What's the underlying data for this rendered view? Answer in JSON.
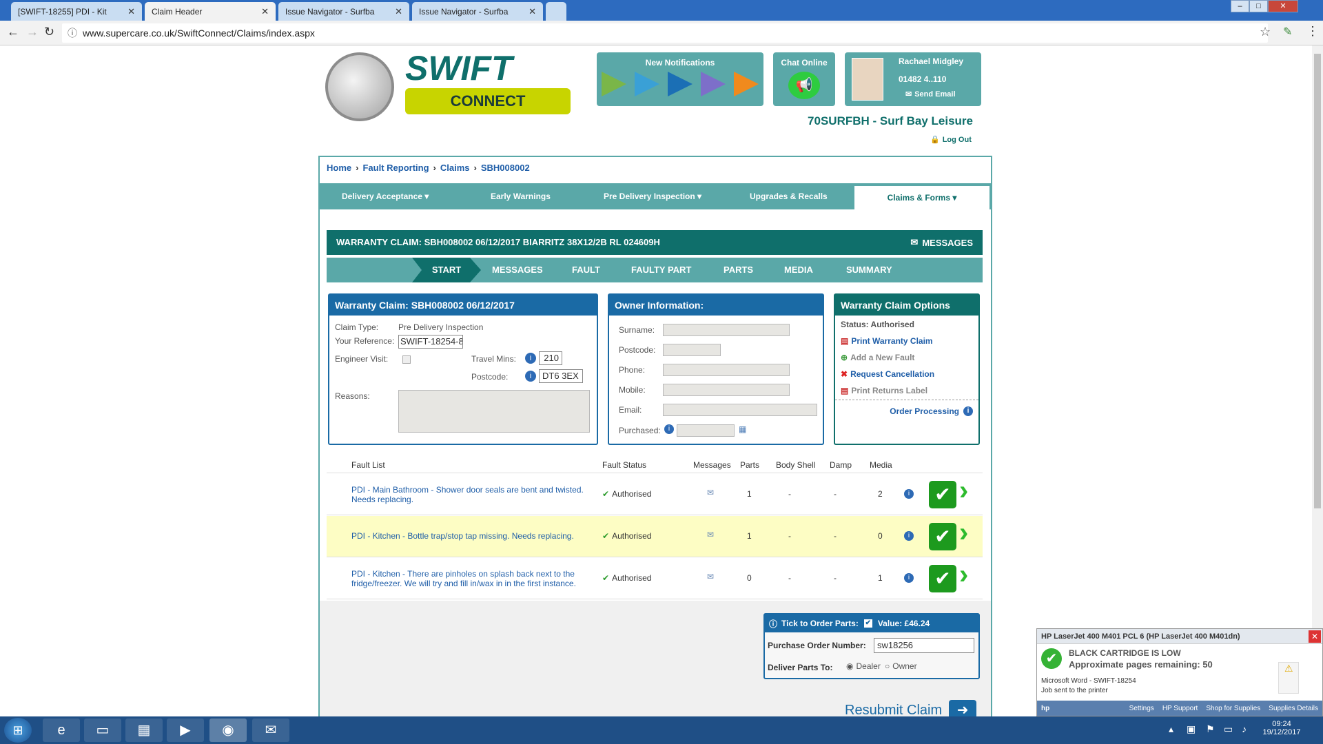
{
  "browser": {
    "tabs": [
      {
        "title": "[SWIFT-18255] PDI - Kit",
        "active": false
      },
      {
        "title": "Claim Header",
        "active": true
      },
      {
        "title": "Issue Navigator - Surfba",
        "active": false
      },
      {
        "title": "Issue Navigator - Surfba",
        "active": false
      }
    ],
    "url": "www.supercare.co.uk/SwiftConnect/Claims/index.aspx"
  },
  "header": {
    "logo_top": "SWIFT",
    "logo_bottom": "CONNECT",
    "notifications_title": "New Notifications",
    "chat_title": "Chat Online",
    "user_name": "Rachael Midgley",
    "user_phone": "01482 4..110",
    "send_email": "Send Email",
    "dealer": "70SURFBH - Surf Bay Leisure",
    "logout": "Log Out"
  },
  "breadcrumb": [
    "Home",
    "Fault Reporting",
    "Claims",
    "SBH008002"
  ],
  "nav": [
    {
      "label": "Delivery Acceptance ▾"
    },
    {
      "label": "Early Warnings"
    },
    {
      "label": "Pre Delivery Inspection ▾"
    },
    {
      "label": "Upgrades & Recalls"
    },
    {
      "label": "Claims & Forms ▾"
    }
  ],
  "claim": {
    "banner": "WARRANTY CLAIM: SBH008002 06/12/2017 BIARRITZ 38X12/2B RL 024609H",
    "messages": "MESSAGES",
    "steps": [
      "START",
      "MESSAGES",
      "FAULT",
      "FAULTY PART",
      "PARTS",
      "MEDIA",
      "SUMMARY"
    ]
  },
  "warranty_panel": {
    "title": "Warranty Claim: SBH008002 06/12/2017",
    "claim_type_label": "Claim Type:",
    "claim_type_value": "Pre Delivery Inspection",
    "reference_label": "Your Reference:",
    "reference_value": "SWIFT-18254-8",
    "engineer_label": "Engineer Visit:",
    "travel_label": "Travel Mins:",
    "travel_value": "210",
    "postcode_label": "Postcode:",
    "postcode_value": "DT6 3EX",
    "reasons_label": "Reasons:"
  },
  "owner_panel": {
    "title": "Owner Information:",
    "fields": [
      "Surname:",
      "Postcode:",
      "Phone:",
      "Mobile:",
      "Email:",
      "Purchased:"
    ]
  },
  "options_panel": {
    "title": "Warranty Claim Options",
    "status": "Status: Authorised",
    "items": [
      "Print Warranty Claim",
      "Add a New Fault",
      "Request Cancellation",
      "Print Returns Label"
    ],
    "order_processing": "Order Processing"
  },
  "fault_table": {
    "headers": [
      "Fault List",
      "Fault Status",
      "Messages",
      "Parts",
      "Body Shell",
      "Damp",
      "Media"
    ],
    "rows": [
      {
        "desc1": "PDI - Main Bathroom - Shower door seals are bent and twisted.",
        "desc2": "Needs replacing.",
        "status": "Authorised",
        "parts": "1",
        "body": "-",
        "damp": "-",
        "media": "2"
      },
      {
        "desc1": "PDI - Kitchen - Bottle trap/stop tap missing. Needs replacing.",
        "desc2": "",
        "status": "Authorised",
        "parts": "1",
        "body": "-",
        "damp": "-",
        "media": "0"
      },
      {
        "desc1": "PDI - Kitchen - There are pinholes on splash back next to the",
        "desc2": "fridge/freezer. We will try and fill in/wax in in the first instance.",
        "status": "Authorised",
        "parts": "0",
        "body": "-",
        "damp": "-",
        "media": "1"
      }
    ]
  },
  "order_box": {
    "tick_label": "Tick to Order Parts:",
    "value": "Value: £46.24",
    "po_label": "Purchase Order Number:",
    "po_value": "sw18256",
    "deliver_label": "Deliver Parts To:",
    "opt1": "Dealer",
    "opt2": "Owner"
  },
  "resubmit": "Resubmit Claim",
  "printer_popup": {
    "title": "HP LaserJet 400 M401 PCL 6 (HP LaserJet 400 M401dn)",
    "line1": "BLACK CARTRIDGE IS LOW",
    "line2": "Approximate pages remaining: 50",
    "doc": "Microsoft Word - SWIFT-18254",
    "sent": "Job sent to the printer",
    "links": [
      "Settings",
      "HP Support",
      "Shop for Supplies",
      "Supplies Details"
    ]
  },
  "taskbar": {
    "time": "09:24",
    "date": "19/12/2017"
  }
}
